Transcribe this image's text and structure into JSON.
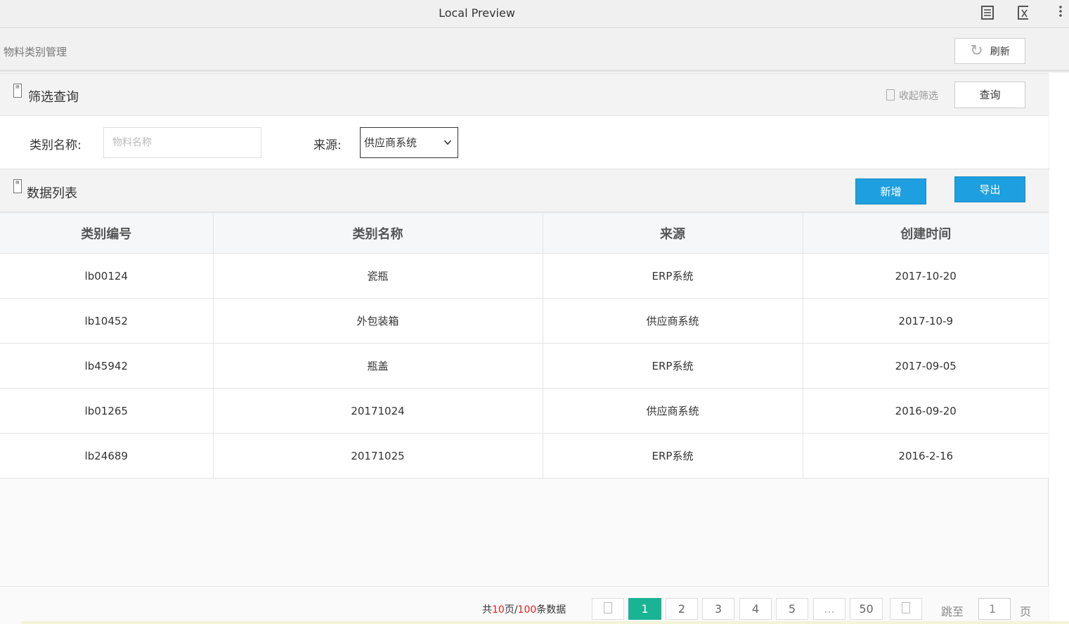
{
  "window": {
    "title": "Local Preview"
  },
  "header": {
    "title": "物料类别管理",
    "refresh_label": "刷新"
  },
  "filter": {
    "title": "筛选查询",
    "collapse_label": "收起筛选",
    "query_label": "查询",
    "name_label": "类别名称:",
    "name_placeholder": "物料名称",
    "source_label": "来源:",
    "source_value": "供应商系统"
  },
  "list": {
    "title": "数据列表",
    "add_label": "新增",
    "export_label": "导出",
    "columns": [
      "类别编号",
      "类别名称",
      "来源",
      "创建时间"
    ],
    "rows": [
      [
        "lb00124",
        "瓷瓶",
        "ERP系统",
        "2017-10-20"
      ],
      [
        "lb10452",
        "外包装箱",
        "供应商系统",
        "2017-10-9"
      ],
      [
        "lb45942",
        "瓶盖",
        "ERP系统",
        "2017-09-05"
      ],
      [
        "lb01265",
        "20171024",
        "供应商系统",
        "2016-09-20"
      ],
      [
        "lb24689",
        "20171025",
        "ERP系统",
        "2016-2-16"
      ]
    ]
  },
  "pagination": {
    "prefix": "共",
    "pages": "10",
    "mid": "页/",
    "total": "100",
    "suffix": "条数据",
    "items": [
      "1",
      "2",
      "3",
      "4",
      "5",
      "...",
      "50"
    ],
    "current": "1",
    "jump_label": "跳至",
    "jump_value": "1",
    "page_unit": "页"
  },
  "colors": {
    "primary": "#1e9fe0",
    "active_page": "#1ab394",
    "highlight": "#e0201c"
  }
}
